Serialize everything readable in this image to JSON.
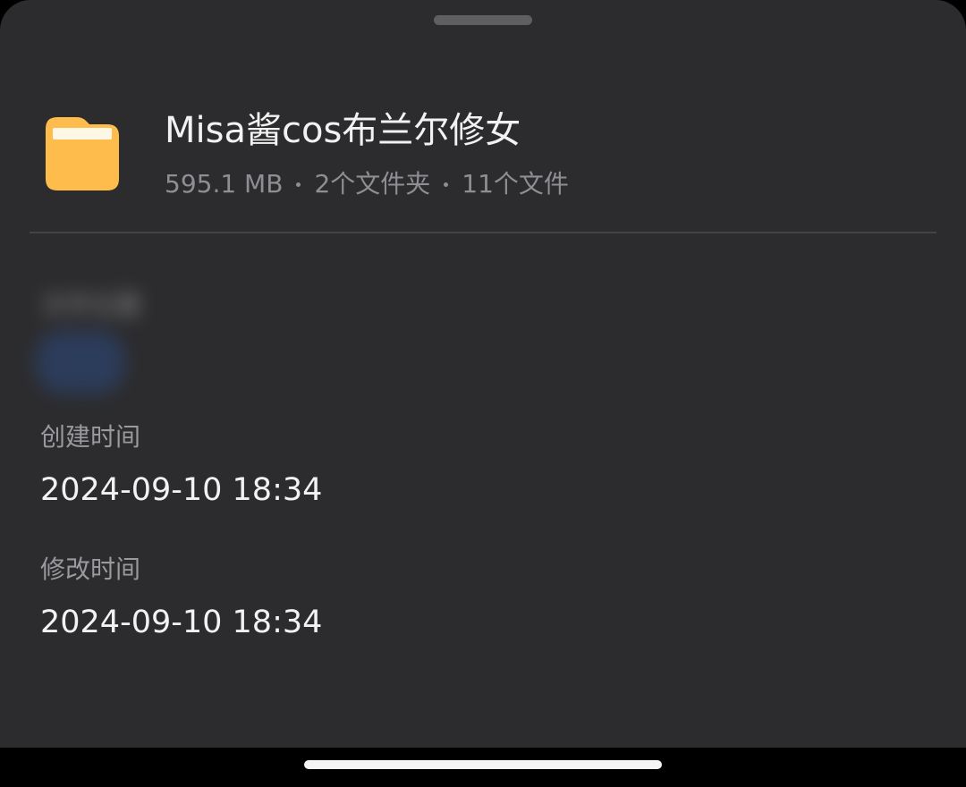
{
  "sheet": {
    "folder": {
      "name": "Misa酱cos布兰尔修女",
      "size": "595.1 MB",
      "folders": "2个文件夹",
      "files": "11个文件",
      "icon": "folder-icon",
      "icon_color": "#FDBC4B"
    },
    "location": {
      "label": "文件位置"
    },
    "created": {
      "label": "创建时间",
      "value": "2024-09-10 18:34"
    },
    "modified": {
      "label": "修改时间",
      "value": "2024-09-10 18:34"
    }
  }
}
